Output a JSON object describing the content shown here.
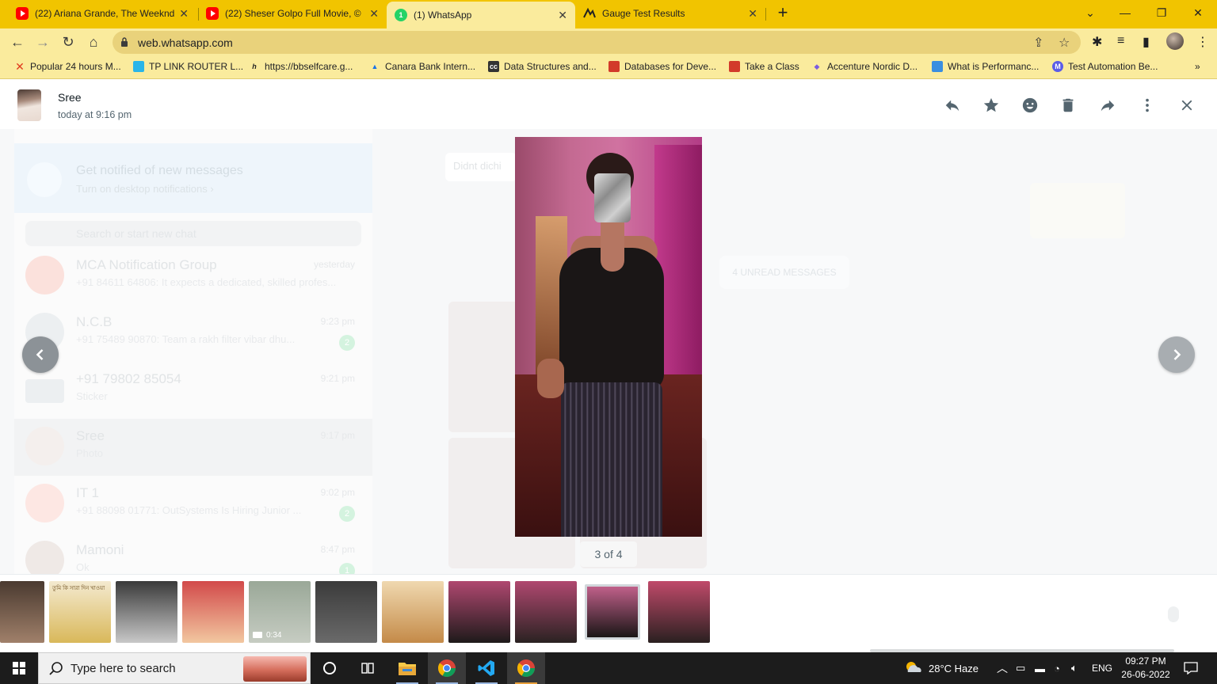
{
  "browser": {
    "tabs": [
      {
        "label": "(22) Ariana Grande, The Weeknd",
        "favicon": "youtube-icon"
      },
      {
        "label": "(22) Sheser Golpo Full Movie, ©",
        "favicon": "youtube-icon"
      },
      {
        "label": "(1) WhatsApp",
        "favicon": "whatsapp-icon",
        "active": true
      },
      {
        "label": "Gauge Test Results",
        "favicon": "gauge-icon"
      }
    ],
    "url": "web.whatsapp.com",
    "bookmarks": [
      "Popular 24 hours M...",
      "TP LINK ROUTER L...",
      "https://bbselfcare.g...",
      "Canara Bank Intern...",
      "Data Structures and...",
      "Databases for Deve...",
      "Take a Class",
      "Accenture Nordic D...",
      "What is Performanc...",
      "Test Automation Be..."
    ],
    "bookmarks_overflow": "»",
    "accent": "#f1c400"
  },
  "background_chat": {
    "notify_title": "Get notified of new messages",
    "notify_sub": "Turn on desktop notifications ›",
    "search_placeholder": "Search or start new chat",
    "chats": [
      {
        "name": "MCA Notification Group",
        "message": "+91 84611 64806: It expects a dedicated, skilled profes...",
        "time": "yesterday"
      },
      {
        "name": "N.C.B",
        "message": "+91 75489 90870: Team a rakh filter vibar dhu...",
        "time": "9:23 pm",
        "badge": "2"
      },
      {
        "name": "+91 79802 85054",
        "message": "Sticker",
        "time": "9:21 pm"
      },
      {
        "name": "Sree",
        "message": "Photo",
        "time": "9:17 pm"
      },
      {
        "name": "IT 1",
        "message": "+91 88098 01771: OutSystems Is Hiring Junior ...",
        "time": "9:02 pm",
        "badge": "2"
      },
      {
        "name": "Mamoni",
        "message": "Ok",
        "time": "8:47 pm",
        "badge": "1"
      }
    ],
    "bubble_text": "Didnt dichi",
    "unread_label": "4 UNREAD MESSAGES"
  },
  "viewer": {
    "sender_name": "Sree",
    "sender_time": "today at 9:16 pm",
    "counter": "3 of 4",
    "header_icons": [
      "reply-icon",
      "star-icon",
      "emoji-icon",
      "delete-icon",
      "forward-icon",
      "menu-icon",
      "close-icon"
    ],
    "thumbnails": [
      {
        "kind": "photo",
        "colors": [
          "#4a3a30",
          "#a0806a"
        ]
      },
      {
        "kind": "image",
        "caption": "তুমি কি সারা দিন খাওয়া",
        "colors": [
          "#f4ead0",
          "#d9b85a"
        ]
      },
      {
        "kind": "image",
        "colors": [
          "#3a3a3a",
          "#c8c8c8"
        ]
      },
      {
        "kind": "image",
        "colors": [
          "#d24a4a",
          "#f2c7a0"
        ]
      },
      {
        "kind": "video",
        "duration": "0:34",
        "colors": [
          "#9aa898",
          "#c6ccc2"
        ]
      },
      {
        "kind": "text-image",
        "colors": [
          "#3b3b3b",
          "#6a6a6a"
        ]
      },
      {
        "kind": "image",
        "colors": [
          "#f0d9b0",
          "#c48a48"
        ]
      },
      {
        "kind": "photo",
        "colors": [
          "#b04870",
          "#1e1a1a"
        ]
      },
      {
        "kind": "photo",
        "colors": [
          "#b04870",
          "#2a2222"
        ]
      },
      {
        "kind": "photo",
        "selected": true,
        "colors": [
          "#c0608a",
          "#1a1616"
        ]
      },
      {
        "kind": "photo",
        "colors": [
          "#c04a6a",
          "#2a2020"
        ]
      }
    ]
  },
  "taskbar": {
    "search_placeholder": "Type here to search",
    "weather": "28°C  Haze",
    "language": "ENG",
    "time": "09:27 PM",
    "date": "26-06-2022"
  }
}
